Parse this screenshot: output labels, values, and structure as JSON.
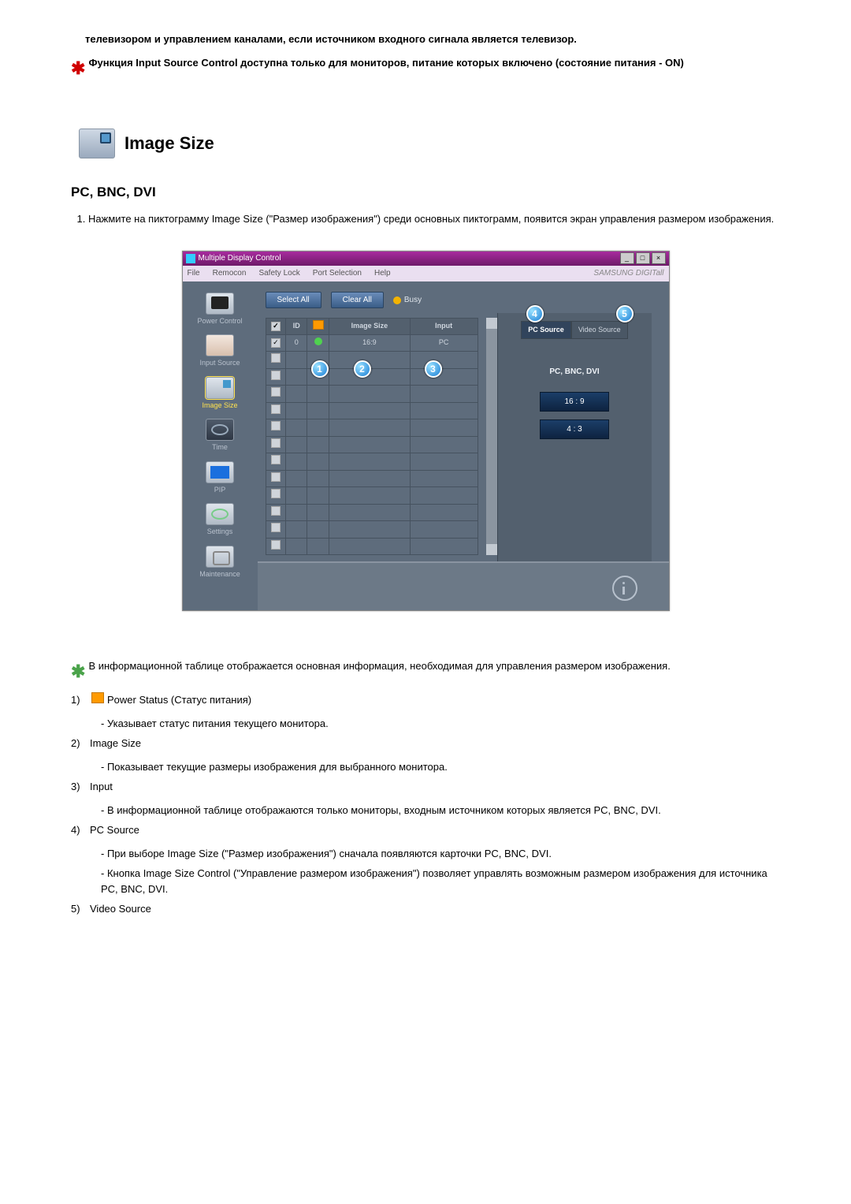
{
  "top_warnings": [
    "телевизором и управлением каналами, если источником входного сигнала является телевизор.",
    "Функция Input Source Control доступна только для мониторов, питание которых включено (состояние питания - ON)"
  ],
  "section_title": "Image Size",
  "sub_heading": "PC, BNC, DVI",
  "numbered_step": "Нажмите на пиктограмму Image Size (\"Размер изображения\") среди основных пиктограмм, появится экран управления размером изображения.",
  "app": {
    "window_title": "Multiple Display Control",
    "menubar": [
      "File",
      "Remocon",
      "Safety Lock",
      "Port Selection",
      "Help"
    ],
    "brand": "SAMSUNG DIGITall",
    "sidebar": [
      {
        "label": "Power Control",
        "icon": "pc"
      },
      {
        "label": "Input Source",
        "icon": "inp"
      },
      {
        "label": "Image Size",
        "icon": "img",
        "active": true
      },
      {
        "label": "Time",
        "icon": "tim"
      },
      {
        "label": "PIP",
        "icon": "pip"
      },
      {
        "label": "Settings",
        "icon": "set"
      },
      {
        "label": "Maintenance",
        "icon": "mnt"
      }
    ],
    "toolbar": {
      "select_all": "Select All",
      "clear_all": "Clear All",
      "busy": "Busy"
    },
    "table": {
      "headers": {
        "id": "ID",
        "image_size": "Image Size",
        "input": "Input"
      },
      "row": {
        "id": "0",
        "size": "16:9",
        "input": "PC"
      }
    },
    "right": {
      "tab_pc": "PC Source",
      "tab_video": "Video Source",
      "label": "PC, BNC, DVI",
      "btn_169": "16 : 9",
      "btn_43": "4 : 3"
    },
    "callouts": {
      "c1": "1",
      "c2": "2",
      "c3": "3",
      "c4": "4",
      "c5": "5"
    }
  },
  "bottom_intro": "В информационной таблице отображается основная информация, необходимая для управления размером изображения.",
  "rows": {
    "r1_title": "Power Status (Статус питания)",
    "r1_line": "- Указывает статус питания текущего монитора.",
    "r2_title": "Image Size",
    "r2_line": "- Показывает текущие размеры изображения для выбранного монитора.",
    "r3_title": "Input",
    "r3_line": "- В информационной таблице отображаются только мониторы, входным источником которых является PC, BNC, DVI.",
    "r4_title": "PC Source",
    "r4_line1": "- При выборе Image Size (\"Размер изображения\") сначала появляются карточки PC, BNC, DVI.",
    "r4_line2": "- Кнопка Image Size Control (\"Управление размером изображения\") позволяет управлять возможным размером изображения для источника PC, BNC, DVI.",
    "r5_title": "Video Source"
  },
  "idx": {
    "i1": "1)",
    "i2": "2)",
    "i3": "3)",
    "i4": "4)",
    "i5": "5)"
  }
}
